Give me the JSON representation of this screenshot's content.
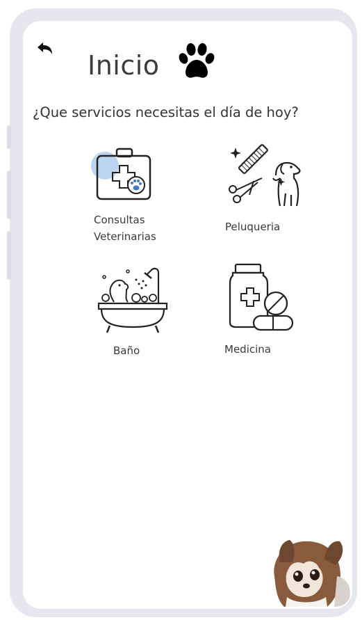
{
  "header": {
    "title": "Inicio",
    "back_icon": "back-arrow-icon",
    "logo_icon": "paw-icon"
  },
  "prompt": "¿Que servicios necesitas el día de hoy?",
  "services": [
    {
      "line1": "Consultas",
      "line2": "Veterinarias",
      "icon": "vet-kit-icon"
    },
    {
      "line1": "Peluqueria",
      "icon": "grooming-icon"
    },
    {
      "line1": "Baño",
      "icon": "bath-icon"
    },
    {
      "line1": "Medicina",
      "icon": "medicine-icon"
    }
  ],
  "colors": {
    "frame": "#e6e6ee",
    "icon_stroke": "#222222",
    "highlight": "#bcd4ef",
    "paw_accent": "#3f77c9"
  },
  "decoration": {
    "mascot_icon": "dog-mascot-icon"
  }
}
